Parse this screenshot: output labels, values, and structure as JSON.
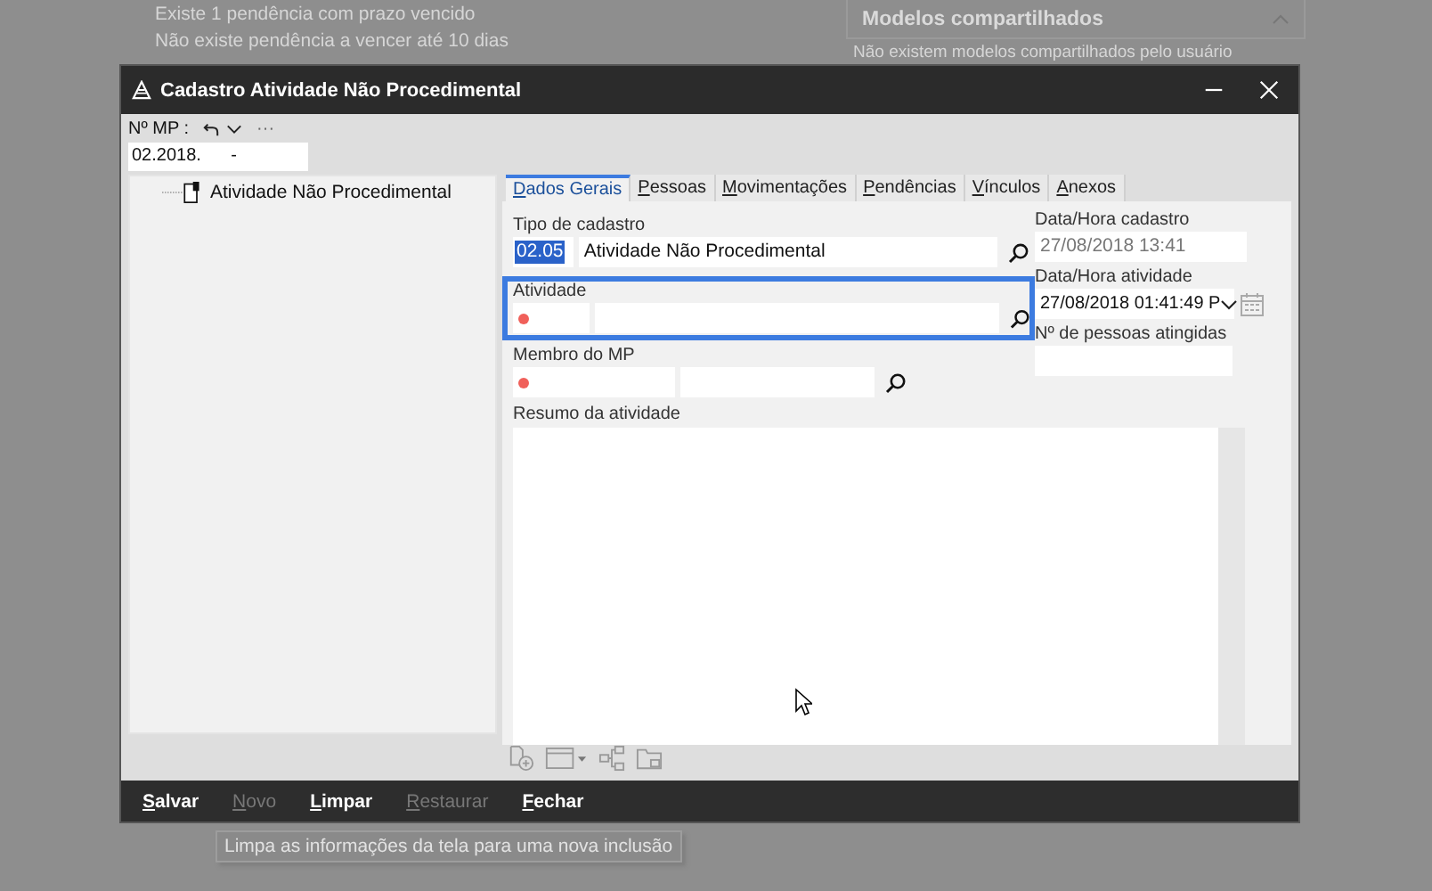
{
  "background": {
    "notices": [
      "Existe 1 pendência com prazo vencido",
      "Não existe pendência a vencer até 10 dias"
    ],
    "shared_models": {
      "title": "Modelos compartilhados",
      "expanded": true,
      "message": "Não existem modelos compartilhados pelo usuário"
    }
  },
  "window": {
    "title": "Cadastro Atividade Não Procedimental"
  },
  "mp": {
    "label": "Nº MP :",
    "value": "02.2018.      -",
    "more": "···"
  },
  "tree": [
    {
      "label": "Atividade Não Procedimental"
    }
  ],
  "tabs": [
    {
      "label": "Dados Gerais",
      "selected": true
    },
    {
      "label": "Pessoas",
      "selected": false
    },
    {
      "label": "Movimentações",
      "selected": false
    },
    {
      "label": "Pendências",
      "selected": false
    },
    {
      "label": "Vínculos",
      "selected": false
    },
    {
      "label": "Anexos",
      "selected": false
    }
  ],
  "form": {
    "tipo": {
      "label": "Tipo de cadastro",
      "code": "02.05",
      "code_selected": true,
      "value": "Atividade Não Procedimental"
    },
    "atividade": {
      "label": "Atividade",
      "focused": true,
      "required": true
    },
    "membro": {
      "label": "Membro do MP",
      "required": true
    },
    "resumo": {
      "label": "Resumo da atividade"
    },
    "data_cadastro": {
      "label": "Data/Hora cadastro",
      "value": "27/08/2018 13:41",
      "disabled": true
    },
    "data_atividade": {
      "label": "Data/Hora atividade",
      "value": "27/08/2018 01:41:49 P"
    },
    "pessoas": {
      "label": "Nº de pessoas atingidas"
    }
  },
  "actions": [
    {
      "label": "Salvar",
      "disabled": false
    },
    {
      "label": "Novo",
      "disabled": true
    },
    {
      "label": "Limpar",
      "disabled": false
    },
    {
      "label": "Restaurar",
      "disabled": true
    },
    {
      "label": "Fechar",
      "disabled": false
    }
  ],
  "tooltip": "Limpa as informações da tela para uma nova inclusão"
}
